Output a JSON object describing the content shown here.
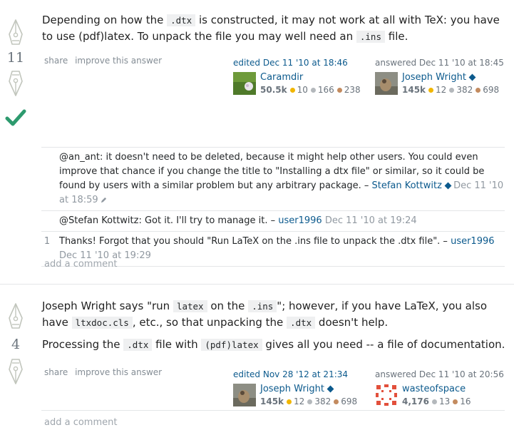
{
  "answer1": {
    "score": "11",
    "accepted": true,
    "body": {
      "t1": "Depending on how the ",
      "c1": ".dtx",
      "t2": " is constructed, it may not work at all with TeX: you have to use (pdf)latex. To unpack the file you may well need an ",
      "c2": ".ins",
      "t3": " file."
    },
    "menu": {
      "share": "share",
      "improve": "improve this answer"
    },
    "edited": {
      "action": "edited Dec 11 '10 at 18:46",
      "user": "Caramdir",
      "rep": "50.5k",
      "gold": "10",
      "silver": "166",
      "bronze": "238"
    },
    "answered": {
      "action": "answered Dec 11 '10 at 18:45",
      "user": "Joseph Wright",
      "rep": "145k",
      "gold": "12",
      "silver": "382",
      "bronze": "698"
    },
    "comments": [
      {
        "score": "",
        "text": "@an_ant: it doesn't need to be deleted, because it might help other users. You could even improve that chance if you change the title to \"Installing a dtx file\" or similar, so it could be found by users with a similar problem but any arbitrary package. – ",
        "user": "Stefan Kottwitz",
        "date": "Dec 11 '10 at 18:59"
      },
      {
        "score": "",
        "text": "@Stefan Kottwitz: Got it. I'll try to manage it. – ",
        "user": "user1996",
        "date": "Dec 11 '10 at 19:24"
      },
      {
        "score": "1",
        "text": "Thanks! Forgot that you should \"Run LaTeX on the .ins file to unpack the .dtx file\". – ",
        "user": "user1996",
        "date": "Dec 11 '10 at 19:29"
      }
    ],
    "add_comment": "add a comment"
  },
  "answer2": {
    "score": "4",
    "body": {
      "p1_t1": "Joseph Wright says \"run ",
      "p1_c1": "latex",
      "p1_t2": " on the ",
      "p1_c2": ".ins",
      "p1_t3": "\"; however, if you have LaTeX, you also have ",
      "p1_c3": "ltxdoc.cls",
      "p1_t4": ", etc., so that unpacking the ",
      "p1_c4": ".dtx",
      "p1_t5": " doesn't help.",
      "p2_t1": "Processing the ",
      "p2_c1": ".dtx",
      "p2_t2": " file with ",
      "p2_c2": "(pdf)latex",
      "p2_t3": " gives all you need -- a file of documentation."
    },
    "menu": {
      "share": "share",
      "improve": "improve this answer"
    },
    "edited": {
      "action": "edited Nov 28 '12 at 21:34",
      "user": "Joseph Wright",
      "rep": "145k",
      "gold": "12",
      "silver": "382",
      "bronze": "698"
    },
    "answered": {
      "action": "answered Dec 11 '10 at 20:56",
      "user": "wasteofspace",
      "rep": "4,176",
      "silver": "13",
      "bronze": "16"
    },
    "add_comment": "add a comment"
  },
  "colors": {
    "link": "#0c5a8d",
    "accepted": "#2d9a6e",
    "gold": "#f1b600",
    "silver": "#b4b8bc",
    "bronze": "#c38b5f"
  }
}
